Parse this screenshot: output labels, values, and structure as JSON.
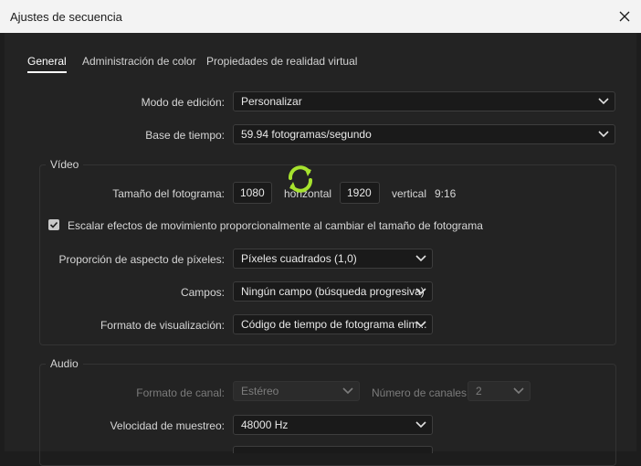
{
  "window": {
    "title": "Ajustes de secuencia",
    "close_icon": "close-icon"
  },
  "tabs": [
    {
      "label": "General",
      "active": true
    },
    {
      "label": "Administración de color",
      "active": false
    },
    {
      "label": "Propiedades de realidad virtual",
      "active": false
    }
  ],
  "general": {
    "edit_mode": {
      "label": "Modo de edición:",
      "value": "Personalizar"
    },
    "timebase": {
      "label": "Base de tiempo:",
      "value": "59.94  fotogramas/segundo"
    }
  },
  "video": {
    "group_title": "Vídeo",
    "frame_size": {
      "label": "Tamaño del fotograma:",
      "horizontal_value": "1080",
      "horizontal_label": "horizontal",
      "vertical_value": "1920",
      "vertical_label": "vertical",
      "aspect": "9:16"
    },
    "scale_checkbox": {
      "checked": true,
      "label": "Escalar efectos de movimiento proporcionalmente al cambiar el tamaño de fotograma"
    },
    "pixel_aspect": {
      "label": "Proporción de aspecto de píxeles:",
      "value": "Píxeles cuadrados (1,0)"
    },
    "fields": {
      "label": "Campos:",
      "value": "Ningún campo (búsqueda progresiva)"
    },
    "display_format": {
      "label": "Formato de visualización:",
      "value": "Código de tiempo de fotograma elim..."
    }
  },
  "audio": {
    "group_title": "Audio",
    "channel_format": {
      "label": "Formato de canal:",
      "value": "Estéreo"
    },
    "channel_count": {
      "label": "Número de canales:",
      "value": "2"
    },
    "sample_rate": {
      "label": "Velocidad de muestreo:",
      "value": "48000 Hz"
    }
  },
  "colors": {
    "accent_sync": "#a6e22e",
    "title_bar": "#f3f3f3",
    "dialog_bg": "#232323"
  }
}
